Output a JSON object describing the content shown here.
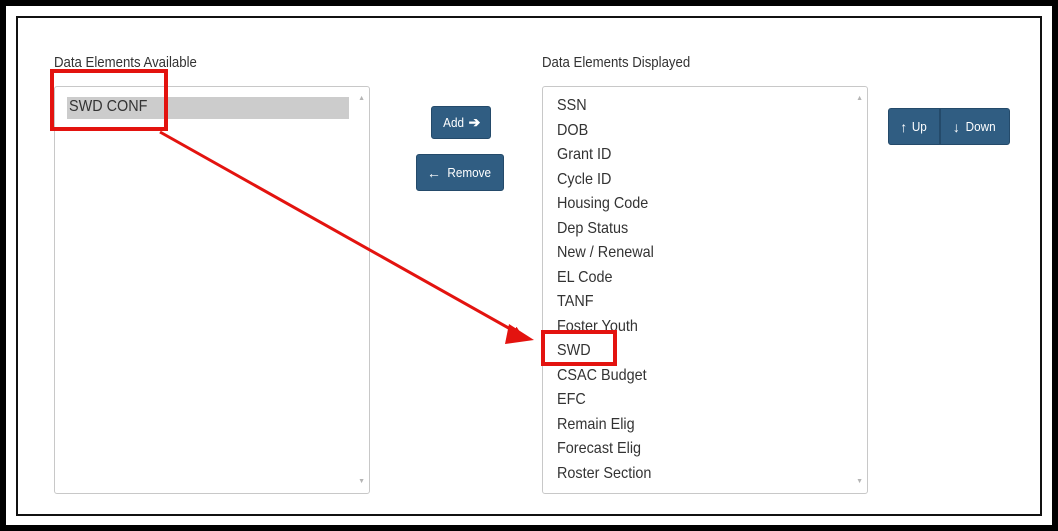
{
  "available": {
    "heading": "Data Elements Available",
    "items": [
      "SWD CONF"
    ]
  },
  "displayed": {
    "heading": "Data Elements Displayed",
    "items": [
      "SSN",
      "DOB",
      "Grant ID",
      "Cycle ID",
      "Housing Code",
      "Dep Status",
      "New / Renewal",
      "EL Code",
      "TANF",
      "Foster Youth",
      "SWD",
      "CSAC Budget",
      "EFC",
      "Remain Elig",
      "Forecast Elig",
      "Roster Section"
    ]
  },
  "buttons": {
    "add_label": "Add",
    "remove_label": "Remove",
    "up_label": "Up",
    "down_label": "Down"
  },
  "icons": {
    "add": "arrow-right-icon",
    "remove": "arrow-left-icon",
    "up": "arrow-up-icon",
    "down": "arrow-down-icon"
  },
  "colors": {
    "button_bg": "#305d82",
    "highlight": "#e3130f",
    "selected_item_bg": "#cccccc"
  }
}
